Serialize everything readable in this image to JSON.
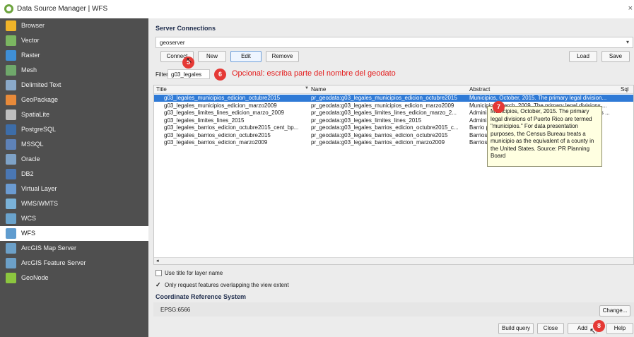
{
  "window": {
    "title": "Data Source Manager | WFS",
    "close_glyph": "×"
  },
  "sidebar": {
    "items": [
      {
        "label": "Browser",
        "icon": "folder-icon",
        "color": "#f0b429"
      },
      {
        "label": "Vector",
        "icon": "vector-icon",
        "color": "#7bb661"
      },
      {
        "label": "Raster",
        "icon": "raster-icon",
        "color": "#3f8fd6"
      },
      {
        "label": "Mesh",
        "icon": "mesh-icon",
        "color": "#6fa86b"
      },
      {
        "label": "Delimited Text",
        "icon": "delimited-text-icon",
        "color": "#8aa9c9"
      },
      {
        "label": "GeoPackage",
        "icon": "geopackage-icon",
        "color": "#e88a3a"
      },
      {
        "label": "SpatiaLite",
        "icon": "spatialite-icon",
        "color": "#bfbfbf"
      },
      {
        "label": "PostgreSQL",
        "icon": "postgresql-icon",
        "color": "#3d6da8"
      },
      {
        "label": "MSSQL",
        "icon": "mssql-icon",
        "color": "#5e82b8"
      },
      {
        "label": "Oracle",
        "icon": "oracle-icon",
        "color": "#7ea2c7"
      },
      {
        "label": "DB2",
        "icon": "db2-icon",
        "color": "#4a77b4"
      },
      {
        "label": "Virtual Layer",
        "icon": "virtual-layer-icon",
        "color": "#6b9bd1"
      },
      {
        "label": "WMS/WMTS",
        "icon": "wms-icon",
        "color": "#7ab2d8"
      },
      {
        "label": "WCS",
        "icon": "wcs-icon",
        "color": "#6aa3cc"
      },
      {
        "label": "WFS",
        "icon": "wfs-icon",
        "color": "#5f9ccf"
      },
      {
        "label": "ArcGIS Map Server",
        "icon": "arcgis-map-server-icon",
        "color": "#6ca0c8"
      },
      {
        "label": "ArcGIS Feature Server",
        "icon": "arcgis-feature-server-icon",
        "color": "#6ca0c8"
      },
      {
        "label": "GeoNode",
        "icon": "geonode-icon",
        "color": "#8cc63f"
      }
    ],
    "active_index": 14
  },
  "server_connections": {
    "title": "Server Connections",
    "selected": "geoserver",
    "dropdown_glyph": "▾",
    "buttons": {
      "connect": "Connect",
      "new": "New",
      "edit": "Edit",
      "remove": "Remove",
      "load": "Load",
      "save": "Save"
    }
  },
  "filter": {
    "label": "Filter",
    "value": "g03_legales",
    "note": "Opcional: escriba parte del nombre del geodato"
  },
  "table": {
    "columns": [
      "Title",
      "Name",
      "Abstract",
      "Sql"
    ],
    "sort_glyph": "▼",
    "rows": [
      {
        "title": "g03_legales_municipios_edicion_octubre2015",
        "name": "pr_geodata:g03_legales_municipios_edicion_octubre2015",
        "abstract": "Municipios, October, 2015.  The primary legal division...",
        "selected": true
      },
      {
        "title": "g03_legales_municipios_edicion_marzo2009",
        "name": "pr_geodata:g03_legales_municipios_edicion_marzo2009",
        "abstract": "Municipios, March, 2009.  The primary legal divisions ...",
        "selected": false
      },
      {
        "title": "g03_legales_limites_lines_edicion_marzo_2009",
        "name": "pr_geodata:g03_legales_limites_lines_edicion_marzo_2...",
        "abstract": "Administrative boundaries, March 2009. Boundar...los ...",
        "selected": false
      },
      {
        "title": "g03_legales_limites_lines_2015",
        "name": "pr_geodata:g03_legales_limites_lines_2015",
        "abstract": "Administrative boundaries ...",
        "selected": false
      },
      {
        "title": "g03_legales_barrios_edicion_octubre2015_cent_bp...",
        "name": "pr_geodata:g03_legales_barrios_edicion_octubre2015_c...",
        "abstract": "Barrio points ... d to...",
        "selected": false
      },
      {
        "title": "g03_legales_barrios_edicion_octubre2015",
        "name": "pr_geodata:g03_legales_barrios_edicion_octubre2015",
        "abstract": "Barrios ... io-...",
        "selected": false
      },
      {
        "title": "g03_legales_barrios_edicion_marzo2009",
        "name": "pr_geodata:g03_legales_barrios_edicion_marzo2009",
        "abstract": "Barrios ... -Pu...",
        "selected": false
      }
    ],
    "scroll_left_glyph": "◂"
  },
  "tooltip": {
    "text": "Municipios, October, 2015. The primary legal divisions of Puerto Rico are termed \"municipios.\" For data presentation purposes, the Census Bureau treats a municipio as the equivalent of a county in the United States. Source: PR Planning Board"
  },
  "options": {
    "use_title": {
      "label": "Use title for layer name",
      "checked": false
    },
    "only_request": {
      "label": "Only request features overlapping the view extent",
      "checked": true
    },
    "check_glyph": "✓"
  },
  "crs": {
    "title": "Coordinate Reference System",
    "value": "EPSG:6566",
    "change_button": "Change..."
  },
  "footer": {
    "build_query": "Build query",
    "close": "Close",
    "add": "Add",
    "help": "Help"
  },
  "badges": {
    "b5": "5",
    "b6": "6",
    "b7": "7",
    "b8": "8"
  },
  "cursor_glyph": "↖"
}
